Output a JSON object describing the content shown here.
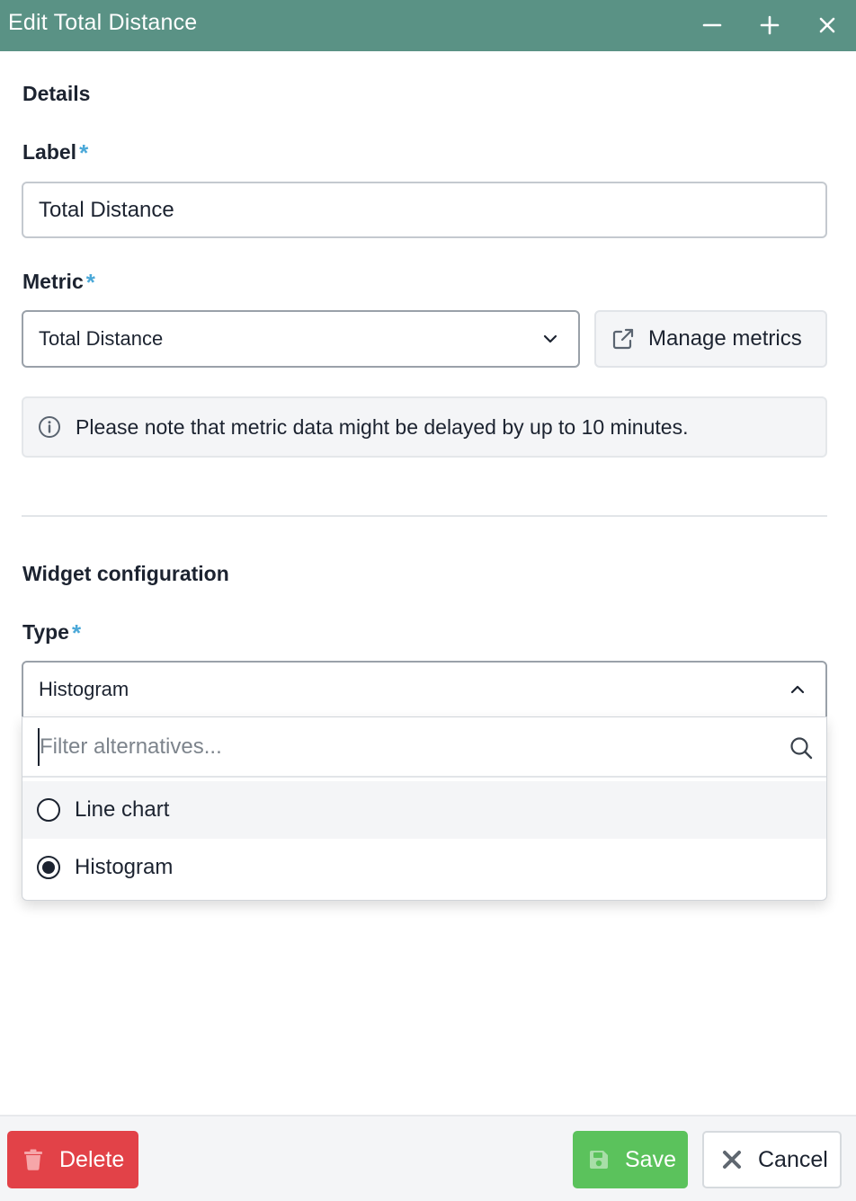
{
  "window": {
    "title": "Edit Total Distance",
    "minimize_icon": "minus-icon",
    "maximize_icon": "plus-icon",
    "close_icon": "close-icon"
  },
  "details": {
    "section_title": "Details",
    "label_field": {
      "label": "Label",
      "required_marker": "*",
      "value": "Total Distance"
    },
    "metric_field": {
      "label": "Metric",
      "required_marker": "*",
      "selected": "Total Distance",
      "manage_button_label": "Manage metrics"
    },
    "notice": {
      "text": "Please note that metric data might be delayed by up to 10 minutes."
    }
  },
  "widget_configuration": {
    "section_title": "Widget configuration",
    "type_field": {
      "label": "Type",
      "required_marker": "*",
      "selected": "Histogram",
      "filter_placeholder": "Filter alternatives...",
      "options": [
        {
          "label": "Line chart",
          "selected": false
        },
        {
          "label": "Histogram",
          "selected": true
        }
      ]
    }
  },
  "footer": {
    "delete_label": "Delete",
    "save_label": "Save",
    "cancel_label": "Cancel"
  },
  "colors": {
    "titlebar": "#5a9285",
    "required": "#4aa8d8",
    "delete": "#e24248",
    "save": "#5bc25c"
  }
}
